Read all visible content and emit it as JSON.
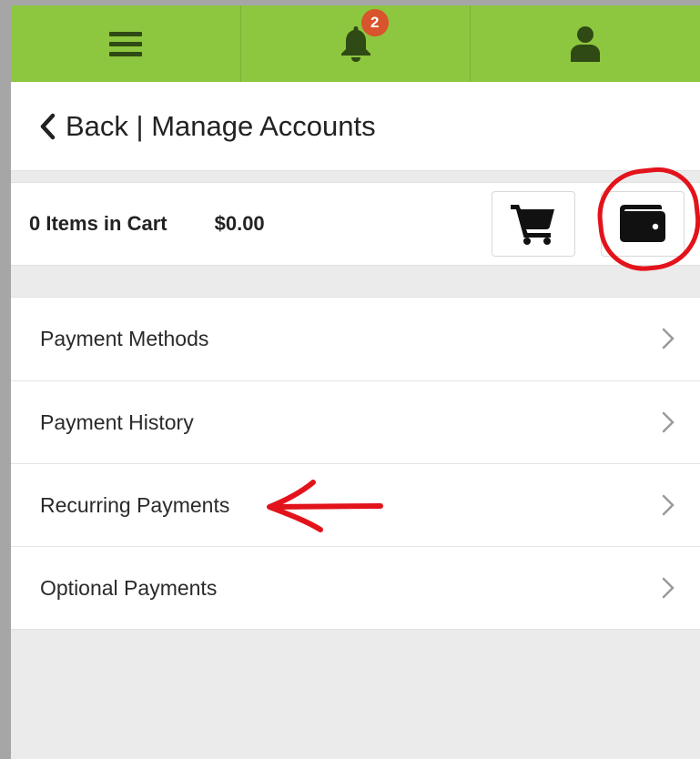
{
  "nav": {
    "notification_count": "2",
    "icons": [
      "hamburger-menu-icon",
      "bell-icon",
      "user-icon"
    ]
  },
  "header": {
    "back_label": "Back | Manage Accounts"
  },
  "cart": {
    "items_label": "0 Items in Cart",
    "total": "$0.00"
  },
  "menu": {
    "items": [
      {
        "label": "Payment Methods"
      },
      {
        "label": "Payment History"
      },
      {
        "label": "Recurring Payments"
      },
      {
        "label": "Optional Payments"
      }
    ]
  },
  "colors": {
    "nav_green": "#8dc63f",
    "nav_icon": "#2f4a14",
    "badge": "#d9532c",
    "annotation_red": "#e3131b"
  }
}
